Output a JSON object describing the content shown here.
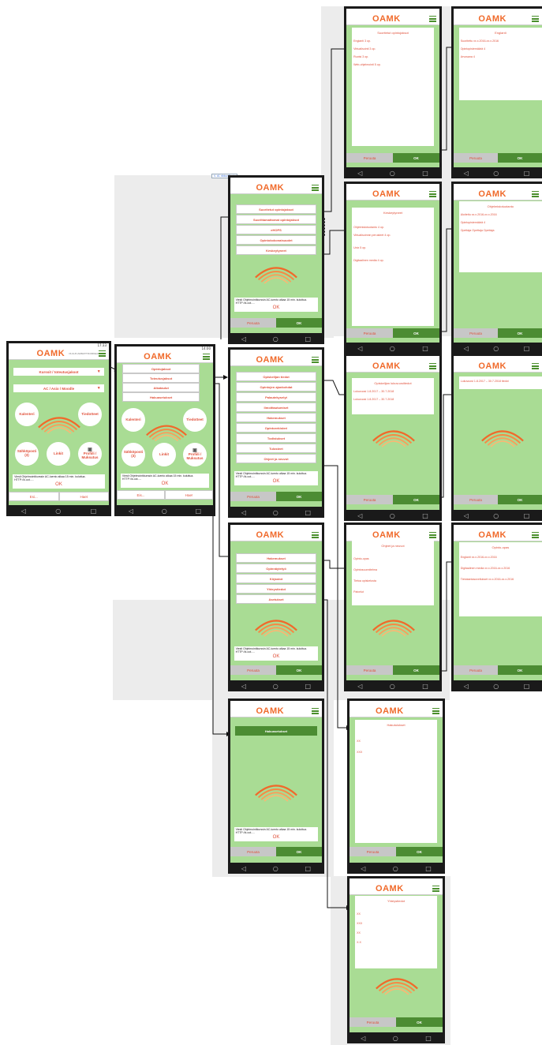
{
  "brand": {
    "logo": "OAMK",
    "sub": "OULUN AMMATTIKORKEAKOULU"
  },
  "status": {
    "time_a": "17:33",
    "time_b": "14:00"
  },
  "tag_label": "V. #1 ribbonPush",
  "nav_icons": {
    "back": "◁",
    "home": "○",
    "recent": "□"
  },
  "common": {
    "cancel": "Peruuta",
    "ok": "OK"
  },
  "icons": [
    "hamburger-menu-icon",
    "oamk-swoosh-logo",
    "user-profile-icon",
    "back-nav-icon",
    "home-nav-icon",
    "recent-apps-icon",
    "dropdown-chevron-icon"
  ],
  "colors": {
    "primary_green": "#4c8c33",
    "screen_green": "#a9dc94",
    "accent_orange": "#e0503a",
    "cancel_grey": "#c7c7c7"
  },
  "home": {
    "dropdown1": "Kurssit / toteutusjaksot",
    "dropdown2": "AC / Asio / Moodle",
    "circles": [
      "Kalenteri",
      "Tiedotteet",
      "Sähköposti (3)",
      "Linkit",
      "Profiili / Muksutus"
    ],
    "message": "Viesti   Ohjelmointikurssin AC-luento alkaa 15 min. kuluttua. HTTP://k.oot.....",
    "message_ok": "OK",
    "btn_left": "Esi...",
    "btn_right": "Haet"
  },
  "home_menu": {
    "items": [
      "Opintojaksot",
      "Toteutusjaksot",
      "Aikataulut",
      "Hakuasetukset"
    ],
    "btn_left": "Eis...",
    "btn_right": "Hae!"
  },
  "opinnot": {
    "items": [
      "Suoritetut opintojaksot",
      "Suorittamattomat opintojaksot",
      "eHOPS",
      "Opintokokonaisuudet",
      "Keskeytyneet"
    ]
  },
  "tiedot": {
    "items": [
      "Opiskelijan tiedot",
      "Opintojen ajankohdat",
      "Palautekyselyt",
      "Ilmoittautumiset",
      "Hakemukset",
      "Opintorekisteri",
      "Todistukset",
      "Tulosteet",
      "Ohjeet ja neuvot"
    ]
  },
  "ilmo": {
    "items": [
      "Hakemukset",
      "Opinnäytetyö",
      "Kirjastot",
      "Yhteystiedot",
      "Asetukset"
    ]
  },
  "haku": {
    "button": "Hakuasetukset"
  },
  "suoritetut": {
    "title": "Suoritetut opintojaksot",
    "items": [
      "Englanti 3 op.",
      "Virtualisointi   3 op.",
      "Ruotsi   3 op.",
      "Web-ohjelmointi   5 op."
    ]
  },
  "englanti": {
    "title": "Englanti",
    "items": [
      "Suoritettu xx.x.2016-xx.x.2016",
      "Opintopistemäärä 4",
      "Arvosana 4"
    ]
  },
  "keskeytyneet": {
    "title": "Keskeytyneet",
    "items": [
      "Ohjelmistotuotanto 4 op.",
      "Virtualisoinnin perusteet 4 op.",
      "Unix 5 op.",
      "Digitaalinen media 4 op."
    ]
  },
  "ohjelmisto": {
    "title": "Ohjelmistotuotanto",
    "items": [
      "Aloitettu xx.x.2016-xx.x.2016",
      "Opintopistemäärä 4",
      "Opettaja Opettaja Opettaja"
    ]
  },
  "lukuvuosi": {
    "title": "Opiskelijan lukuvuositiedot",
    "items": [
      "Lukuvuosi 1.8.2017 – 30.7.2018",
      "Lukuvuosi 1.8.2017 – 30.7.2018"
    ]
  },
  "lukuvuosi2": {
    "item": "Lukuvuosi 1.8.2017 – 30.7.2018 tiedot"
  },
  "ohjeet": {
    "title": "Ohjeet ja neuvot",
    "items": [
      "Opinto-opas",
      "Opintosuunnitelma",
      "Tietoa opiskelusta",
      "Palvelut"
    ]
  },
  "opas": {
    "title": "Opinto-opas",
    "items": [
      "Englanti xx.x.2016-xx.x.2016",
      "Digitaalinen media xx.x.2016-xx.x.2016",
      "Tietokantasovellukset xx.x.2016-xx.x.2016"
    ]
  },
  "hakukone": {
    "title": "Hakutulokset",
    "items": [
      "XX",
      "XXX"
    ]
  },
  "yhteystiedot": {
    "title": "Yhteystiedot",
    "items": [
      "XX",
      "XXX",
      "XX",
      "X.X"
    ]
  }
}
